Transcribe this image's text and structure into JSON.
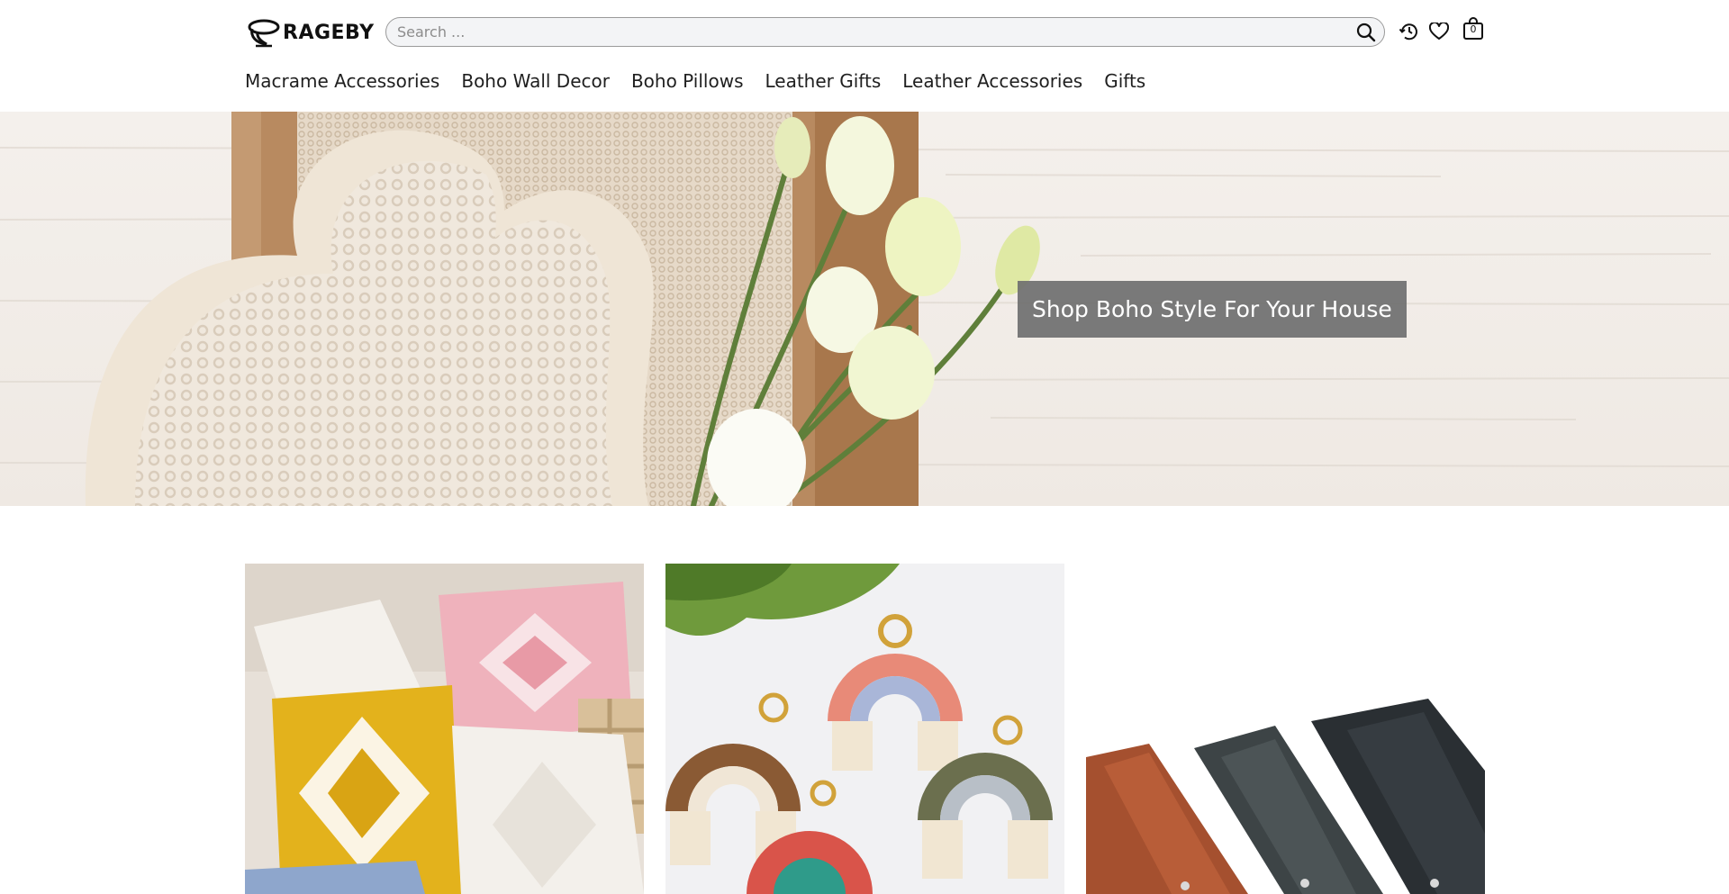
{
  "brand": {
    "name": "RAGEBY"
  },
  "search": {
    "placeholder": "Search ..."
  },
  "header": {
    "icons": [
      "logo-swirl-icon",
      "search-icon",
      "history-icon",
      "heart-icon",
      "shopping-bag-icon"
    ],
    "cart_count": "0"
  },
  "nav": {
    "items": [
      {
        "label": "Macrame Accessories"
      },
      {
        "label": "Boho Wall Decor"
      },
      {
        "label": "Boho Pillows"
      },
      {
        "label": "Leather Gifts"
      },
      {
        "label": "Leather Accessories"
      },
      {
        "label": "Gifts"
      }
    ]
  },
  "hero": {
    "cta_label": "Shop Boho Style For Your House",
    "colors": {
      "background": "#f3efeb",
      "overlay": "#707070",
      "text": "#ffffff"
    }
  },
  "products": [
    {
      "image": "boho-pillows-photo"
    },
    {
      "image": "macrame-rainbow-keychains-photo"
    },
    {
      "image": "leather-accessories-photo"
    }
  ]
}
